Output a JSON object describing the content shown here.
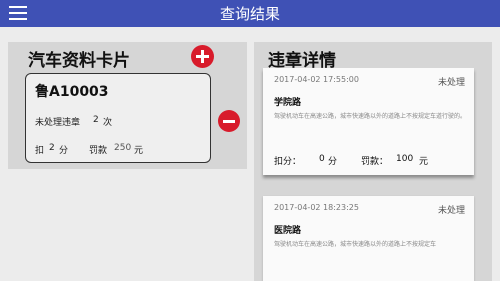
{
  "header": {
    "title": "查询结果",
    "menu_icon": "menu-icon"
  },
  "vehicle_panel": {
    "title": "汽车资料卡片",
    "add_icon": "plus-circle-icon",
    "card": {
      "plate": "鲁A10003",
      "unhandled_label": "未处理违章",
      "unhandled_count": "2",
      "unhandled_unit": "次",
      "deduct_label": "扣",
      "deduct_value": "2",
      "deduct_unit": "分",
      "fine_label": "罚款",
      "fine_value": "250",
      "fine_unit": "元"
    },
    "remove_icon": "minus-circle-icon"
  },
  "violation_panel": {
    "title": "违章详情",
    "records": [
      {
        "time": "2017-04-02 17:55:00",
        "status": "未处理",
        "road": "学院路",
        "description": "驾驶机动车在高速公路，城市快速路以外的道路上不按规定车道行驶的。",
        "score_label": "扣分：",
        "score_value": "0",
        "score_unit": "分",
        "amount_label": "罚款：",
        "amount_value": "100",
        "amount_unit": "元"
      },
      {
        "time": "2017-04-02 18:23:25",
        "status": "未处理",
        "road": "医院路",
        "description": "驾驶机动车在高速公路，城市快速路以外的道路上不按规定车"
      }
    ]
  },
  "colors": {
    "topbar": "#3f51b5",
    "accent_red": "#d81b2b",
    "panel": "#d6d6d6"
  }
}
